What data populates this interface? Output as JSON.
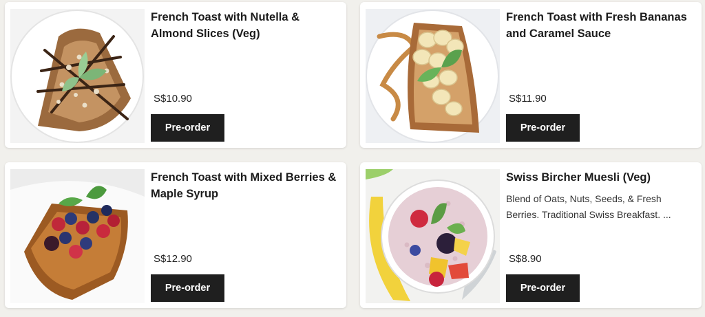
{
  "colors": {
    "background": "#f1f0ec",
    "card": "#ffffff",
    "button": "#1f1f1f",
    "button_text": "#ffffff"
  },
  "items": [
    {
      "title": "French Toast with Nutella & Almond Slices (Veg)",
      "description": "",
      "price": "S$10.90",
      "cta": "Pre-order"
    },
    {
      "title": "French Toast with Fresh Bananas and Caramel Sauce",
      "description": "",
      "price": "S$11.90",
      "cta": "Pre-order"
    },
    {
      "title": "French Toast with Mixed Berries & Maple Syrup",
      "description": "",
      "price": "S$12.90",
      "cta": "Pre-order"
    },
    {
      "title": "Swiss Bircher Muesli (Veg)",
      "description": "Blend of Oats, Nuts, Seeds, & Fresh Berries. Traditional Swiss Breakfast. ...",
      "price": "S$8.90",
      "cta": "Pre-order"
    }
  ]
}
